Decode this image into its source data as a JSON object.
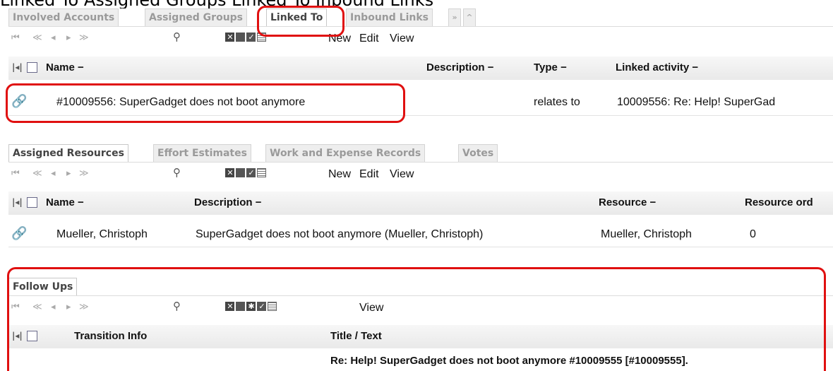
{
  "top_cut_text": "Linked To    Assigned Groups    Linked To    Inbound Links",
  "panel1": {
    "tabs": [
      "Involved Accounts",
      "Assigned Groups",
      "Linked To",
      "Inbound Links",
      "»",
      "^"
    ],
    "active_tab": "Linked To",
    "toolbar": {
      "new": "New",
      "edit": "Edit",
      "view": "View"
    },
    "columns": {
      "name": "Name",
      "description": "Description",
      "type": "Type",
      "linked": "Linked activity"
    },
    "sort_marker": "−",
    "rows": [
      {
        "name": "#10009556: SuperGadget does not boot anymore",
        "description": "",
        "type": "relates to",
        "linked": "10009556: Re: Help! SuperGad"
      }
    ]
  },
  "panel2": {
    "tabs": [
      "Assigned Resources",
      "Effort Estimates",
      "Work and Expense Records",
      "Votes"
    ],
    "active_tab": "Assigned Resources",
    "toolbar": {
      "new": "New",
      "edit": "Edit",
      "view": "View"
    },
    "columns": {
      "name": "Name",
      "description": "Description",
      "resource": "Resource",
      "resource_order": "Resource ord"
    },
    "rows": [
      {
        "name": "Mueller, Christoph",
        "description": "SuperGadget does not boot anymore (Mueller, Christoph)",
        "resource": "Mueller, Christoph",
        "resource_order": "0"
      }
    ]
  },
  "panel3": {
    "tabs": [
      "Follow Ups"
    ],
    "active_tab": "Follow Ups",
    "toolbar": {
      "view": "View"
    },
    "columns": {
      "transition": "Transition Info",
      "title": "Title / Text"
    },
    "rows": [
      {
        "transition": "",
        "title": "Re: Help! SuperGadget does not boot anymore #10009555 [#10009555]."
      }
    ]
  },
  "icons": {
    "first": "⏮",
    "prev_fast": "«",
    "prev": "◀",
    "next": "▶",
    "last": "»",
    "search": "🔍",
    "col_toggle": "Ⅰ◄"
  },
  "accent": {
    "highlight": "#e01010",
    "tab_text": "#9a9a9a"
  }
}
